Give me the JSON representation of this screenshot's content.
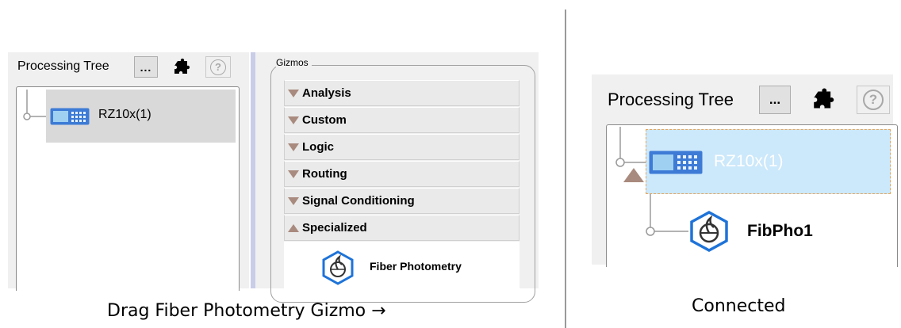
{
  "left_panel": {
    "title": "Processing Tree",
    "more_button": "...",
    "help_glyph": "?",
    "device": "RZ10x(1)"
  },
  "gizmos": {
    "title": "Gizmos",
    "categories": [
      {
        "label": "Analysis",
        "state": "collapsed"
      },
      {
        "label": "Custom",
        "state": "collapsed"
      },
      {
        "label": "Logic",
        "state": "collapsed"
      },
      {
        "label": "Routing",
        "state": "collapsed"
      },
      {
        "label": "Signal Conditioning",
        "state": "collapsed"
      },
      {
        "label": "Specialized",
        "state": "expanded"
      }
    ],
    "item": "Fiber Photometry"
  },
  "caption_left": "Drag Fiber Photometry Gizmo →",
  "right_panel": {
    "title": "Processing Tree",
    "more_button": "...",
    "help_glyph": "?",
    "device": "RZ10x(1)",
    "child": "FibPho1"
  },
  "caption_right": "Connected",
  "icons": [
    "more-button",
    "puzzle-icon",
    "help-icon",
    "device-icon",
    "fiber-photometry-icon",
    "collapse-triangle-icon",
    "expand-triangle-icon",
    "tree-connector-icon"
  ],
  "colors": {
    "accent_blue": "#1e73d8",
    "device_blue": "#3d7bd6",
    "triangle_brown": "#a98a7e",
    "selection_blue": "#cce8fb",
    "selection_gray": "#d9d9d9"
  }
}
